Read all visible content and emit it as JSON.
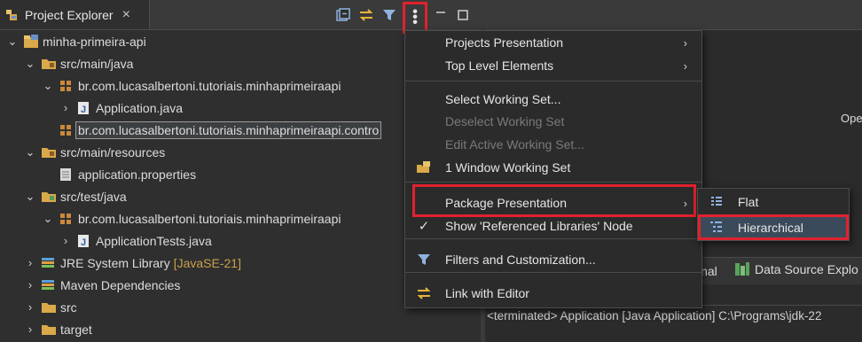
{
  "explorer": {
    "tab_title": "Project Explorer",
    "close_glyph": "×",
    "toolbar": {
      "collapse_icon": "collapse-all-icon",
      "link_icon": "link-with-editor-icon",
      "filter_icon": "filter-icon",
      "view_menu_glyph": "⋮",
      "minimize_glyph": "▭",
      "maximize_glyph": "☐"
    },
    "tree": [
      {
        "chev": "⌄",
        "icon": "project-icon",
        "label": "minha-primeira-api",
        "extra": ""
      },
      {
        "chev": "⌄",
        "icon": "source-folder-icon",
        "label": "src/main/java",
        "extra": ""
      },
      {
        "chev": "⌄",
        "icon": "package-icon",
        "label": "br.com.lucasalbertoni.tutoriais.minhaprimeiraapi",
        "extra": ""
      },
      {
        "chev": "›",
        "icon": "java-file-icon",
        "label": "Application.java",
        "extra": ""
      },
      {
        "chev": "",
        "icon": "package-icon",
        "label": "br.com.lucasalbertoni.tutoriais.minhaprimeiraapi.contro",
        "extra": ""
      },
      {
        "chev": "⌄",
        "icon": "source-folder-icon",
        "label": "src/main/resources",
        "extra": ""
      },
      {
        "chev": "",
        "icon": "properties-file-icon",
        "label": "application.properties",
        "extra": ""
      },
      {
        "chev": "⌄",
        "icon": "test-folder-icon",
        "label": "src/test/java",
        "extra": ""
      },
      {
        "chev": "⌄",
        "icon": "package-icon",
        "label": "br.com.lucasalbertoni.tutoriais.minhaprimeiraapi",
        "extra": ""
      },
      {
        "chev": "›",
        "icon": "java-file-icon",
        "label": "ApplicationTests.java",
        "extra": ""
      },
      {
        "chev": "›",
        "icon": "library-icon",
        "label": "JRE System Library",
        "extra": "[JavaSE-21]"
      },
      {
        "chev": "›",
        "icon": "library-icon",
        "label": "Maven Dependencies",
        "extra": ""
      },
      {
        "chev": "›",
        "icon": "folder-icon",
        "label": "src",
        "extra": ""
      },
      {
        "chev": "›",
        "icon": "folder-icon",
        "label": "target",
        "extra": ""
      }
    ]
  },
  "view_menu": {
    "items": [
      {
        "label": "Projects Presentation",
        "submenu": true,
        "enabled": true,
        "icon": ""
      },
      {
        "label": "Top Level Elements",
        "submenu": true,
        "enabled": true,
        "icon": ""
      },
      {
        "label": "Select Working Set...",
        "submenu": false,
        "enabled": true,
        "icon": ""
      },
      {
        "label": "Deselect Working Set",
        "submenu": false,
        "enabled": false,
        "icon": ""
      },
      {
        "label": "Edit Active Working Set...",
        "submenu": false,
        "enabled": false,
        "icon": ""
      },
      {
        "label": "1 Window Working Set",
        "submenu": false,
        "enabled": true,
        "icon": "working-set-icon"
      },
      {
        "label": "Package Presentation",
        "submenu": true,
        "enabled": true,
        "icon": ""
      },
      {
        "label": "Show 'Referenced Libraries' Node",
        "submenu": false,
        "enabled": true,
        "icon": "checkmark-icon"
      },
      {
        "label": "Filters and Customization...",
        "submenu": false,
        "enabled": true,
        "icon": "filter-icon"
      },
      {
        "label": "Link with Editor",
        "submenu": false,
        "enabled": true,
        "icon": "link-with-editor-icon"
      }
    ],
    "arrow_glyph": "›",
    "check_glyph": "✓"
  },
  "package_presentation_submenu": {
    "items": [
      {
        "label": "Flat",
        "icon": "flat-layout-icon"
      },
      {
        "label": "Hierarchical",
        "icon": "hierarchical-layout-icon"
      }
    ]
  },
  "right": {
    "partial_text": "Ope",
    "terminal_tab_partial": "inal",
    "data_source_tab": "Data Source Explo",
    "console_text": "<terminated> Application [Java Application] C:\\Programs\\jdk-22"
  },
  "colors": {
    "highlight_red": "#e0222e",
    "background": "#2b2b2b",
    "text": "#dcdcdc",
    "disabled_text": "#7a7a7a",
    "library_version": "#c9a04a",
    "selected_submenu_bg": "#3b4a5a"
  }
}
